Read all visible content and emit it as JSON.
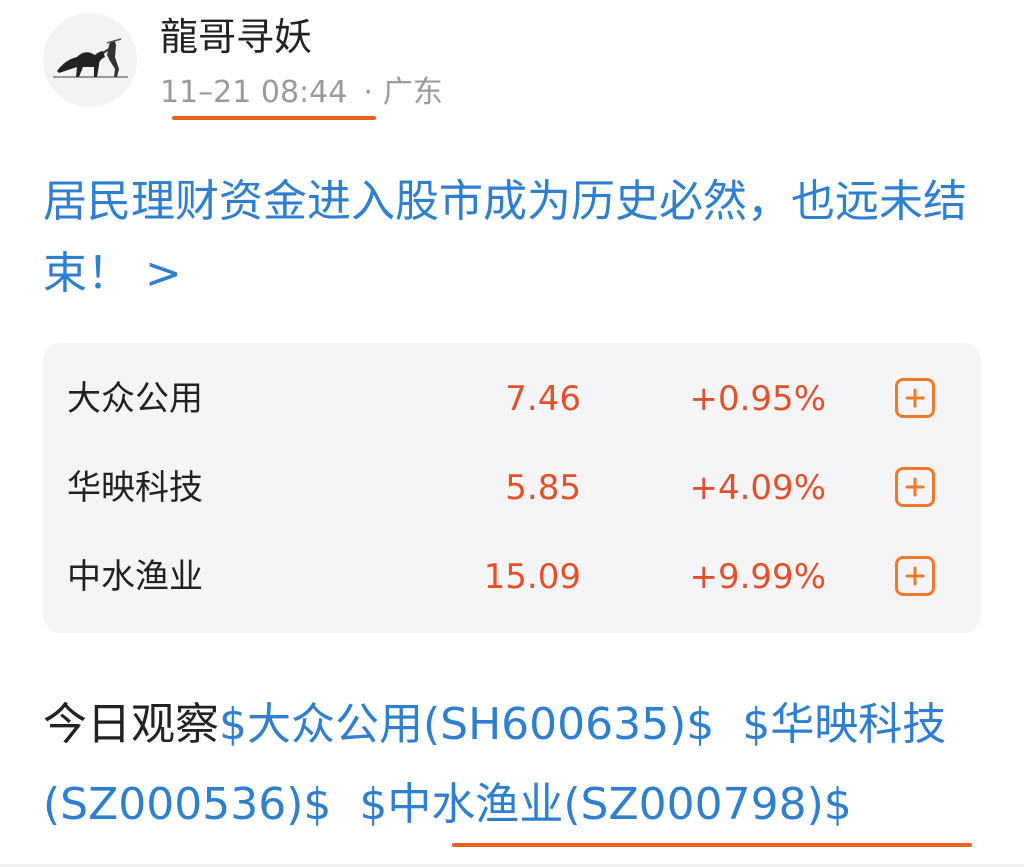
{
  "author": {
    "name": "龍哥寻妖",
    "avatar_icon": "horse-rider-ink-avatar"
  },
  "post": {
    "timestamp": "11–21 08:44",
    "dot": "·",
    "location": "广东",
    "headline": "居民理财资金进入股市成为历史必然，也远未结束！ >"
  },
  "stocks": [
    {
      "name": "大众公用",
      "price": "7.46",
      "change": "+0.95%",
      "add_icon": "plus-icon"
    },
    {
      "name": "华映科技",
      "price": "5.85",
      "change": "+4.09%",
      "add_icon": "plus-icon"
    },
    {
      "name": "中水渔业",
      "price": "15.09",
      "change": "+9.99%",
      "add_icon": "plus-icon"
    }
  ],
  "body": {
    "intro": "今日观察",
    "tags": [
      "$大众公用(SH600635)$",
      "$华映科技(SZ000536)$",
      "$中水渔业(SZ000798)$"
    ]
  },
  "colors": {
    "link_blue": "#2f7fd1",
    "price_red": "#e5502a",
    "accent_orange": "#f07a2a",
    "highlight_underline": "#e8611d"
  }
}
